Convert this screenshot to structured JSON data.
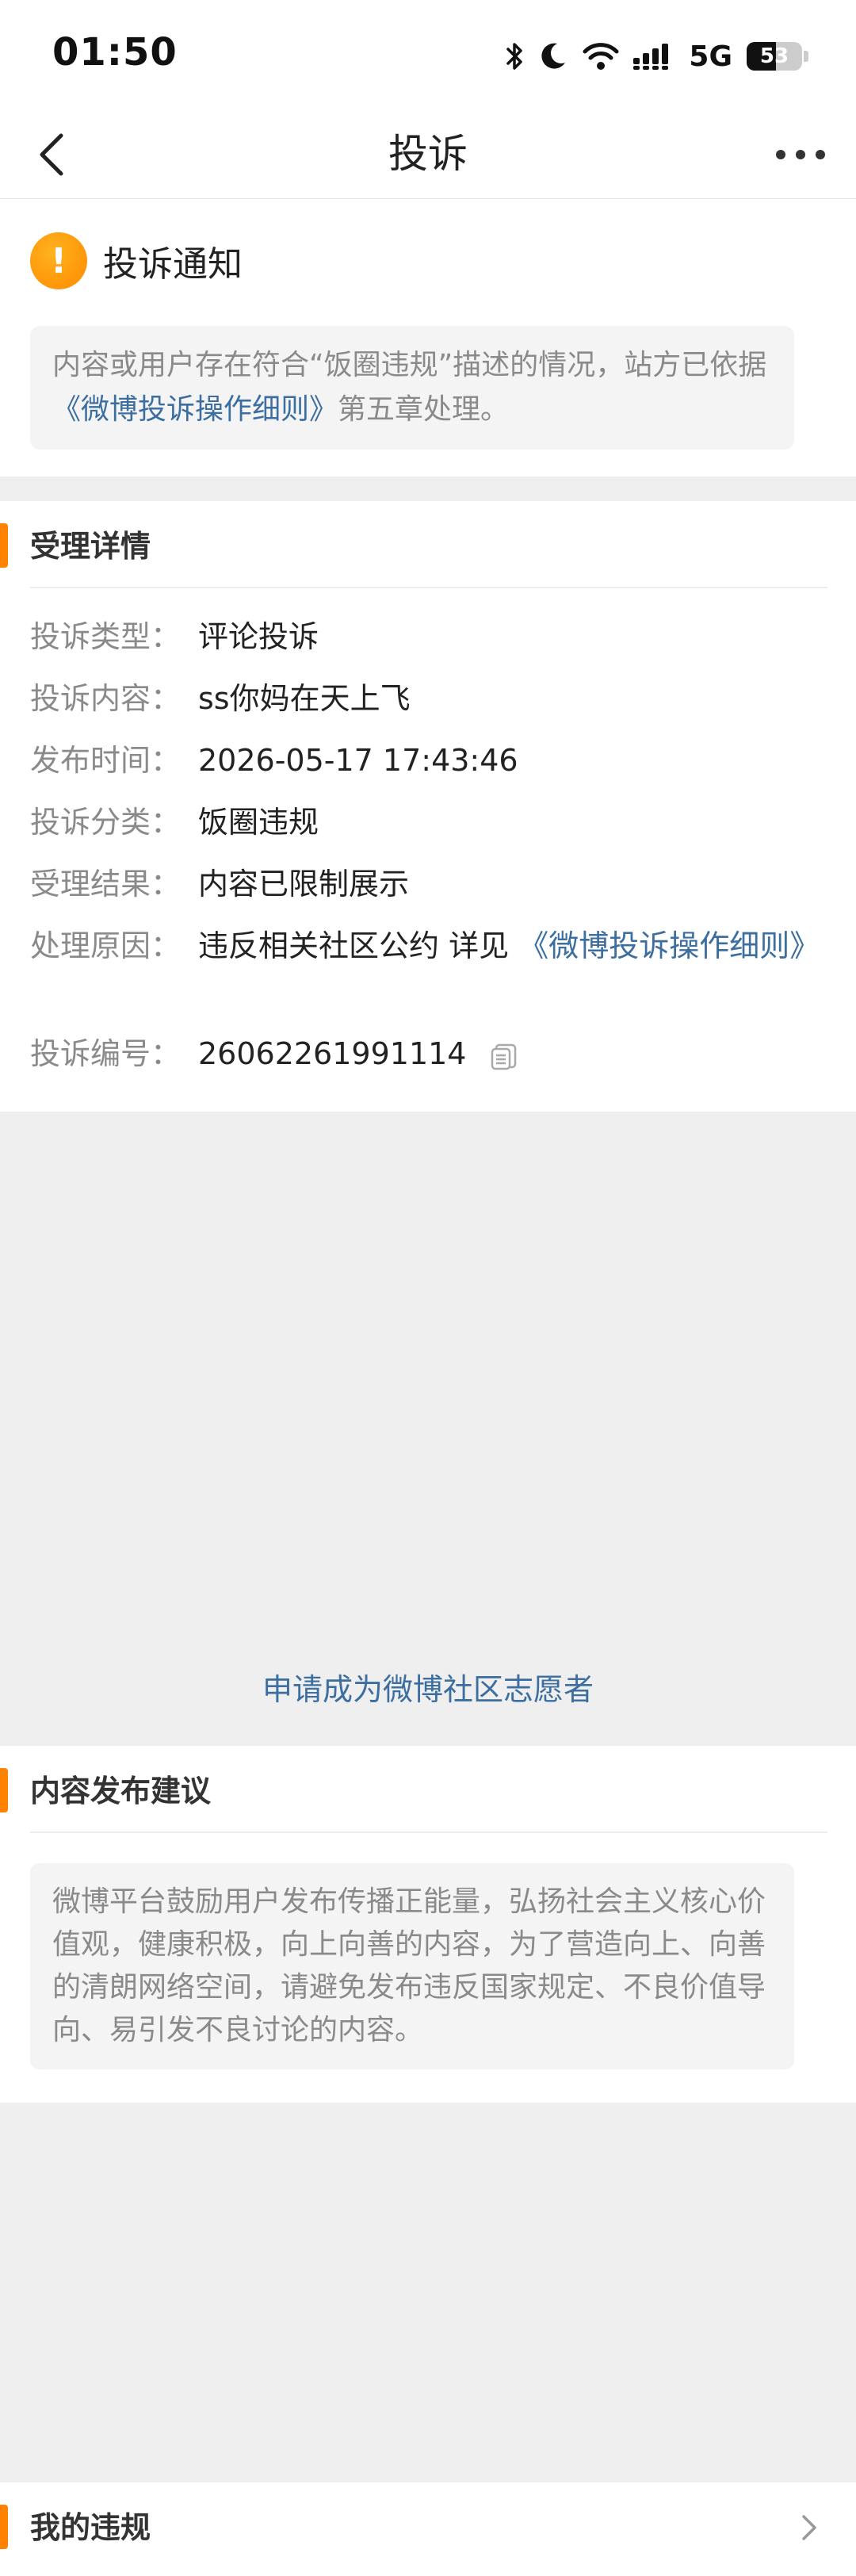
{
  "status_bar": {
    "time": "01:50",
    "network": "5G",
    "battery_level": "53",
    "battery_fraction": 0.53,
    "icons": [
      "bluetooth-icon",
      "moon-icon",
      "wifi-icon",
      "signal-icon"
    ]
  },
  "nav": {
    "title": "投诉",
    "back_icon": "chevron-left-icon",
    "more_icon": "more-dots-icon"
  },
  "notice": {
    "title": "投诉通知",
    "icon": "warning-icon",
    "text_before": "内容或用户存在符合“饭圈违规”描述的情况，站方已依据",
    "rule_link": "《微博投诉操作细则》",
    "text_after": "第五章处理。"
  },
  "details": {
    "section_title": "受理详情",
    "rows": [
      {
        "label": "投诉类型：",
        "value": "评论投诉"
      },
      {
        "label": "投诉内容：",
        "value": "ss你妈在天上飞"
      },
      {
        "label": "发布时间：",
        "value": "2026-05-17 17:43:46"
      },
      {
        "label": "投诉分类：",
        "value": "饭圈违规"
      },
      {
        "label": "受理结果：",
        "value": "内容已限制展示"
      },
      {
        "label": "处理原因：",
        "value": "违反相关社区公约 详见",
        "link": "《微博投诉操作细则》"
      },
      {
        "label": "投诉编号：",
        "value": "26062261991114"
      }
    ]
  },
  "advice": {
    "section_title": "内容发布建议",
    "text": "微博平台鼓励用户发布传播正能量，弘扬社会主义核心价值观，健康积极，向上向善的内容，为了营造向上、向善的清朗网络空间，请避免发布违反国家规定、不良价值导向、易引发不良讨论的内容。"
  },
  "violations": {
    "section_title": "我的违规"
  },
  "footer": {
    "volunteer_link": "申请成为微博社区志愿者"
  },
  "colors": {
    "accent": "#ff8200",
    "link": "#3c6ea0",
    "muted_text": "#8a8a8a",
    "background": "#efefef"
  }
}
